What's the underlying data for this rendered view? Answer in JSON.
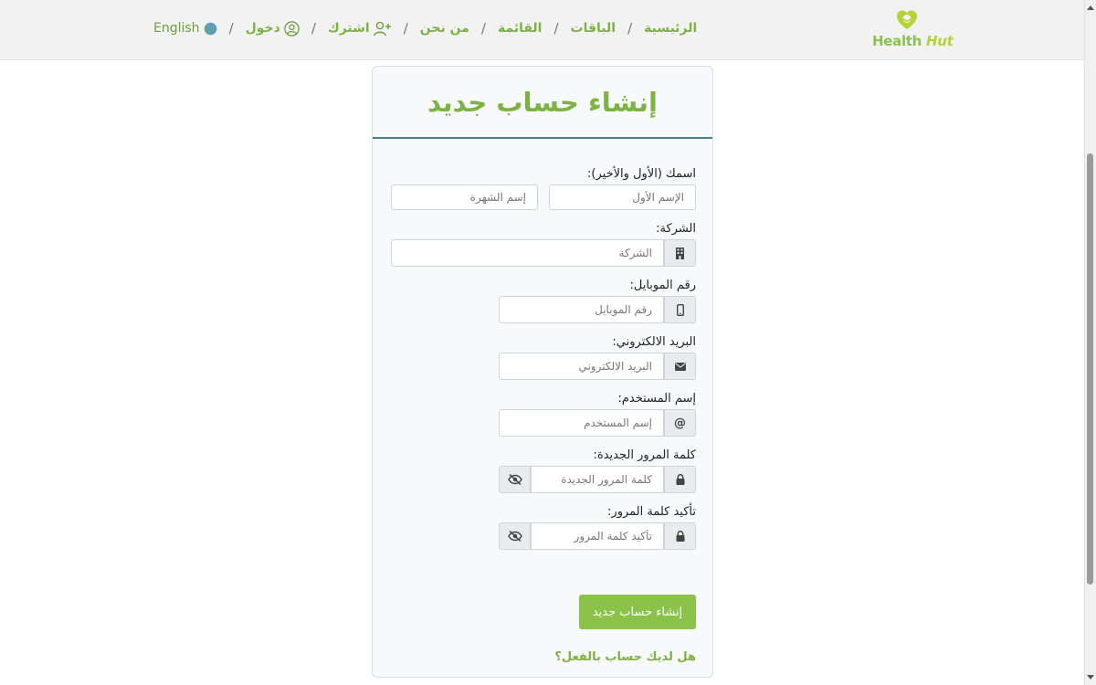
{
  "nav": {
    "home": "الرئيسية",
    "packages": "الباقات",
    "list": "القائمة",
    "about": "من نحن",
    "subscribe": "اشترك",
    "login": "دخول",
    "language": "English",
    "separator": "/"
  },
  "logo": {
    "word_health": "Health",
    "word_hut": "Hut"
  },
  "form": {
    "title": "إنشاء حساب جديد",
    "name_label": "اسمك (الأول والأخير):",
    "first_name_placeholder": "الإسم الأول",
    "nickname_placeholder": "إسم الشهرة",
    "company_label": "الشركة:",
    "company_placeholder": "الشركة",
    "mobile_label": "رقم الموبايل:",
    "mobile_placeholder": "رقم الموبايل",
    "email_label": "البريد الالكتروني:",
    "email_placeholder": "البريد الالكتروني",
    "username_label": "إسم المستخدم:",
    "username_placeholder": "إسم المستخدم",
    "username_addon": "@",
    "password_label": "كلمة المرور الجديدة:",
    "password_placeholder": "كلمة المرور الجديدة",
    "confirm_label": "تأكيد كلمة المرور:",
    "confirm_placeholder": "تأكيد كلمة المرور",
    "submit_label": "إنشاء حساب جديد",
    "login_link": "هل لديك حساب بالفعل؟"
  },
  "colors": {
    "brand_green": "#7cb342",
    "button_green": "#8bc34a",
    "header_rule": "#4b7f87"
  }
}
